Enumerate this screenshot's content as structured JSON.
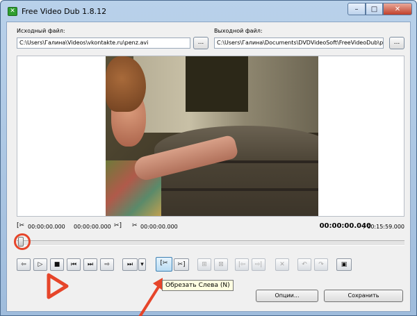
{
  "window": {
    "title": "Free Video Dub 1.8.12",
    "app_icon_glyph": "✕"
  },
  "titlebar_buttons": {
    "minimize_glyph": "–",
    "maximize_glyph": "□",
    "close_glyph": "✕"
  },
  "source": {
    "label": "Исходный файл:",
    "path": "C:\\Users\\Галина\\Videos\\vkontakte.ru\\penz.avi",
    "browse_label": "..."
  },
  "output": {
    "label": "Выходной файл:",
    "path": "C:\\Users\\Галина\\Documents\\DVDVideoSoft\\FreeVideoDub\\penz.avi",
    "browse_label": "..."
  },
  "timeline": {
    "sel_start_icon": "[✂",
    "sel_start": "00:00:00.000",
    "sel_end": "00:00:00.000",
    "sel_end_icon": "✂]",
    "sel_len_icon": "✂",
    "sel_len": "00:00:00.000",
    "position": "00:00:00.040",
    "duration": "/ 00:15:59.000",
    "seek_progress": 0
  },
  "controls": {
    "prev_frame": "⇦",
    "play": "▷",
    "stop": "■",
    "go_start": "⏮",
    "go_end": "⏭",
    "next_frame": "⇨",
    "next_scene": "⏭",
    "dropdown": "▾",
    "cut_left": "[✂",
    "cut_right": "✂]",
    "mark_a": "⊞",
    "mark_b": "⊠",
    "sel_prev": "|⇦",
    "sel_next": "⇨|",
    "delete": "✕",
    "undo": "↶",
    "redo": "↷",
    "fit": "▣"
  },
  "tooltip": {
    "text": "Обрезать Слева (N)"
  },
  "buttons": {
    "options_label": "Опции...",
    "save_label": "Сохранить"
  },
  "colors": {
    "annotation_red": "#e6452a",
    "active_blue": "#3c7fb1"
  }
}
